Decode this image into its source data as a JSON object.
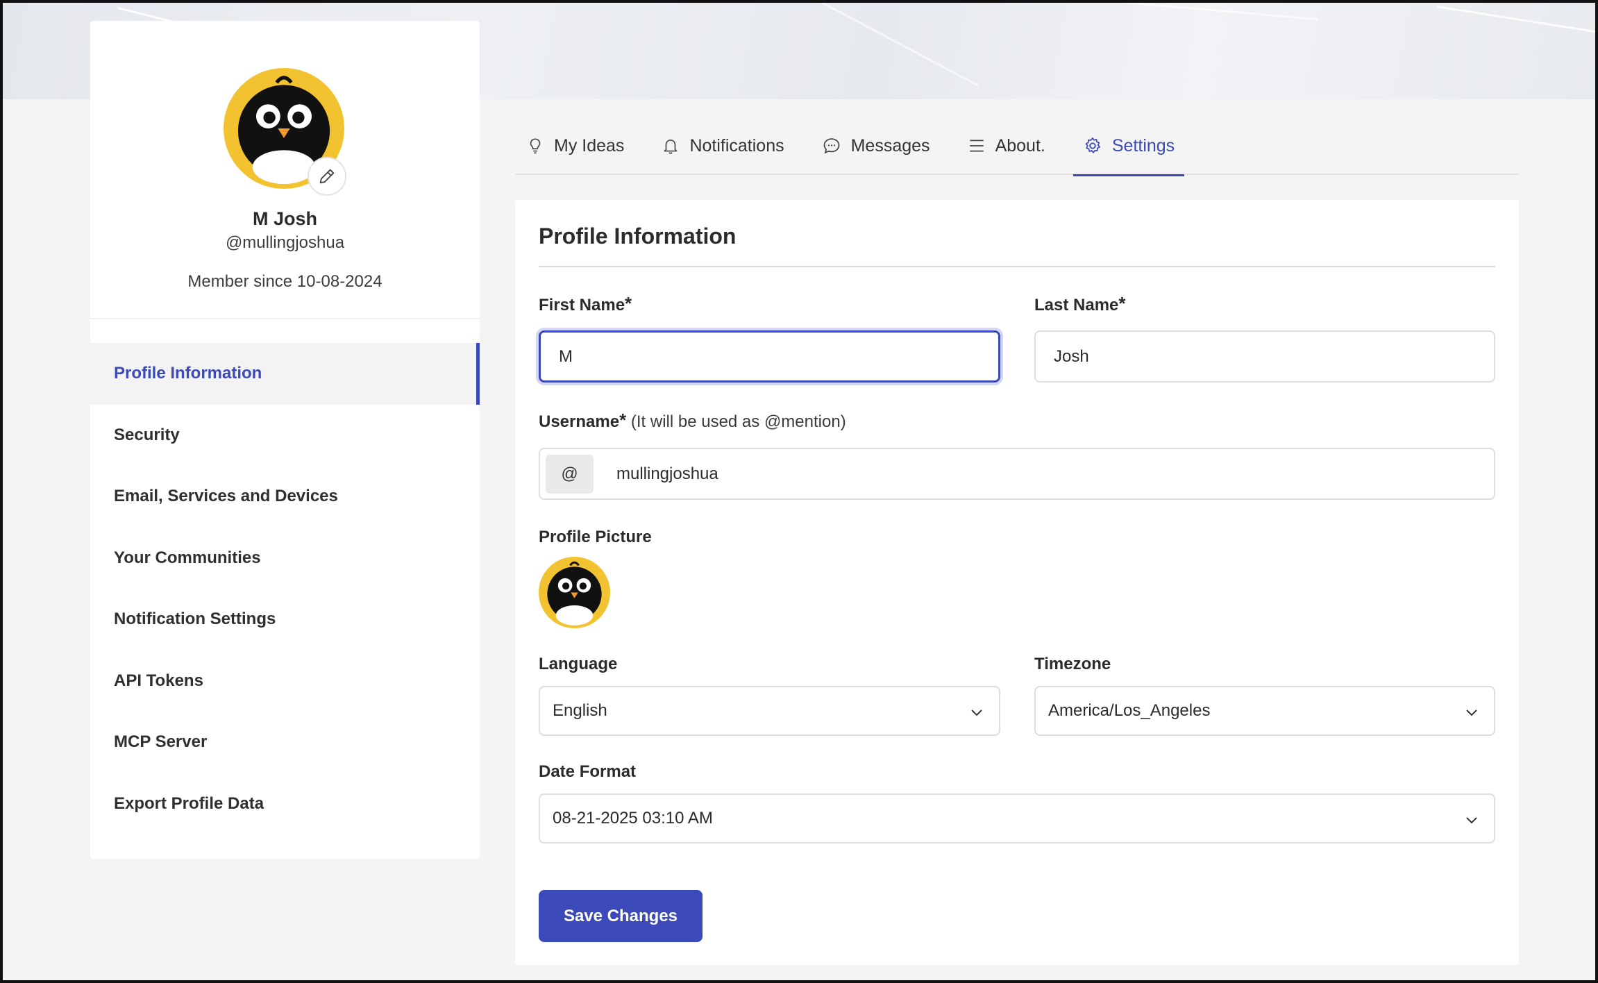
{
  "colors": {
    "accent": "#3b4ab8",
    "avatar_bg": "#f2c230"
  },
  "profile": {
    "name": "M Josh",
    "handle": "@mullingjoshua",
    "member_since": "Member since 10-08-2024",
    "avatar_icon": "penguin-avatar",
    "edit_icon": "pencil-icon"
  },
  "sidebar": {
    "items": [
      {
        "label": "Profile Information",
        "active": true
      },
      {
        "label": "Security"
      },
      {
        "label": "Email, Services and Devices"
      },
      {
        "label": "Your Communities"
      },
      {
        "label": "Notification Settings"
      },
      {
        "label": "API Tokens"
      },
      {
        "label": "MCP Server"
      },
      {
        "label": "Export Profile Data"
      }
    ]
  },
  "tabs": [
    {
      "label": "My Ideas",
      "icon": "lightbulb-icon"
    },
    {
      "label": "Notifications",
      "icon": "bell-icon"
    },
    {
      "label": "Messages",
      "icon": "chat-bubble-icon"
    },
    {
      "label": "About.",
      "icon": "menu-lines-icon"
    },
    {
      "label": "Settings",
      "icon": "gear-icon",
      "active": true
    }
  ],
  "form": {
    "title": "Profile Information",
    "first_name": {
      "label": "First Name",
      "required": "*",
      "value": "M"
    },
    "last_name": {
      "label": "Last Name",
      "required": "*",
      "value": "Josh"
    },
    "username": {
      "label": "Username",
      "required": "*",
      "hint": "(It will be used as @mention)",
      "prefix": "@",
      "value": "mullingjoshua"
    },
    "profile_picture": {
      "label": "Profile Picture"
    },
    "language": {
      "label": "Language",
      "value": "English"
    },
    "timezone": {
      "label": "Timezone",
      "value": "America/Los_Angeles"
    },
    "date_format": {
      "label": "Date Format",
      "value": "08-21-2025 03:10 AM"
    },
    "save_label": "Save Changes"
  }
}
